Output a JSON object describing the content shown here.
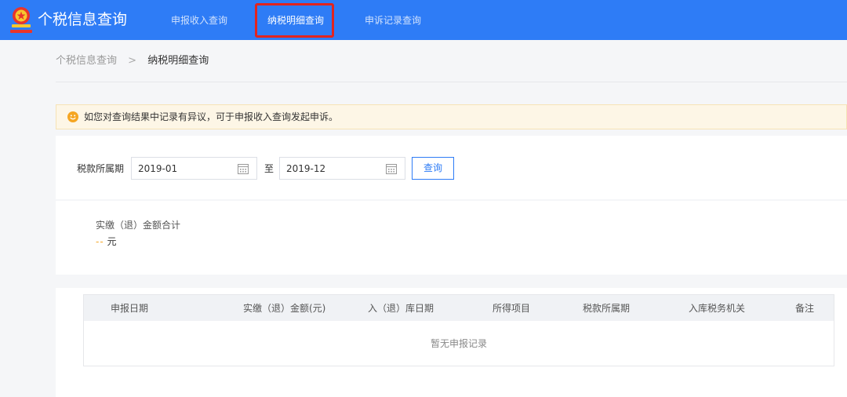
{
  "header": {
    "app_title": "个税信息查询",
    "emblem_icon": "national-emblem-icon",
    "nav": [
      {
        "label": "申报收入查询",
        "active": false
      },
      {
        "label": "纳税明细查询",
        "active": true
      },
      {
        "label": "申诉记录查询",
        "active": false
      }
    ],
    "highlight_color": "#e2241e",
    "bar_color": "#2e7cf6"
  },
  "breadcrumb": {
    "home": "个税信息查询",
    "separator": ">",
    "current": "纳税明细查询"
  },
  "notice": {
    "icon": "smiley-warning-icon",
    "text": "如您对查询结果中记录有异议，可于申报收入查询发起申诉。"
  },
  "filter": {
    "label": "税款所属期",
    "start": "2019-01",
    "separator": "至",
    "end": "2019-12",
    "calendar_icon": "calendar-icon",
    "query_label": "查询"
  },
  "summary": {
    "label": "实缴（退）金额合计",
    "value": "--",
    "unit": "元"
  },
  "table": {
    "columns": [
      "申报日期",
      "实缴（退）金额(元)",
      "入（退）库日期",
      "所得项目",
      "税款所属期",
      "入库税务机关",
      "备注"
    ],
    "rows": [],
    "empty_text": "暂无申报记录"
  }
}
